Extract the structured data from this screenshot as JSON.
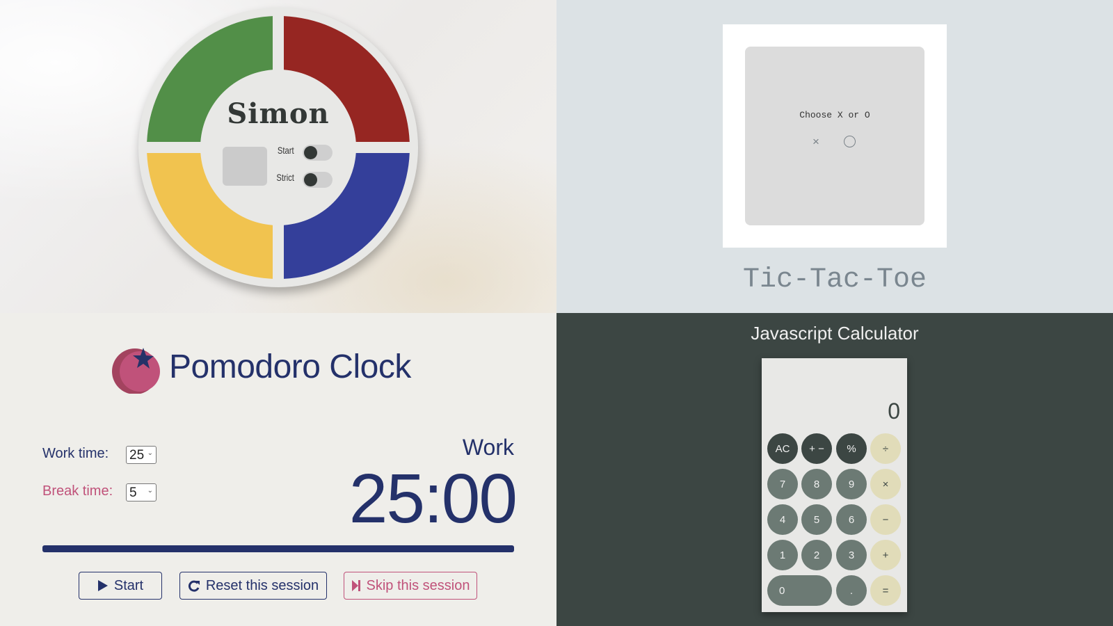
{
  "simon": {
    "title": "Simon",
    "start_label": "Start",
    "strict_label": "Strict",
    "start_on": false,
    "strict_on": false,
    "count_display": "",
    "colors": {
      "green": "#528f48",
      "red": "#962622",
      "yellow": "#f1c34f",
      "blue": "#343f9a"
    }
  },
  "tictactoe": {
    "prompt": "Choose X or O",
    "choice_x": "×",
    "choice_o": "○",
    "title": "Tic-Tac-Toe"
  },
  "pomodoro": {
    "title": "Pomodoro Clock",
    "work_label": "Work time:",
    "work_value": "25",
    "break_label": "Break time:",
    "break_value": "5",
    "mode": "Work",
    "timer": "25:00",
    "progress_percent": 100,
    "buttons": {
      "start": "Start",
      "reset": "Reset this session",
      "skip": "Skip this session"
    },
    "colors": {
      "primary": "#24316a",
      "accent": "#c0527a"
    }
  },
  "calculator": {
    "title": "Javascript Calculator",
    "display": "0",
    "buttons": [
      {
        "label": "AC",
        "kind": "fn"
      },
      {
        "label": "+ −",
        "kind": "fn"
      },
      {
        "label": "%",
        "kind": "fn"
      },
      {
        "label": "÷",
        "kind": "op"
      },
      {
        "label": "7",
        "kind": "num"
      },
      {
        "label": "8",
        "kind": "num"
      },
      {
        "label": "9",
        "kind": "num"
      },
      {
        "label": "×",
        "kind": "op"
      },
      {
        "label": "4",
        "kind": "num"
      },
      {
        "label": "5",
        "kind": "num"
      },
      {
        "label": "6",
        "kind": "num"
      },
      {
        "label": "−",
        "kind": "op"
      },
      {
        "label": "1",
        "kind": "num"
      },
      {
        "label": "2",
        "kind": "num"
      },
      {
        "label": "3",
        "kind": "num"
      },
      {
        "label": "+",
        "kind": "op"
      },
      {
        "label": "0",
        "kind": "num"
      },
      {
        "label": ".",
        "kind": "num"
      },
      {
        "label": "=",
        "kind": "op"
      }
    ]
  }
}
